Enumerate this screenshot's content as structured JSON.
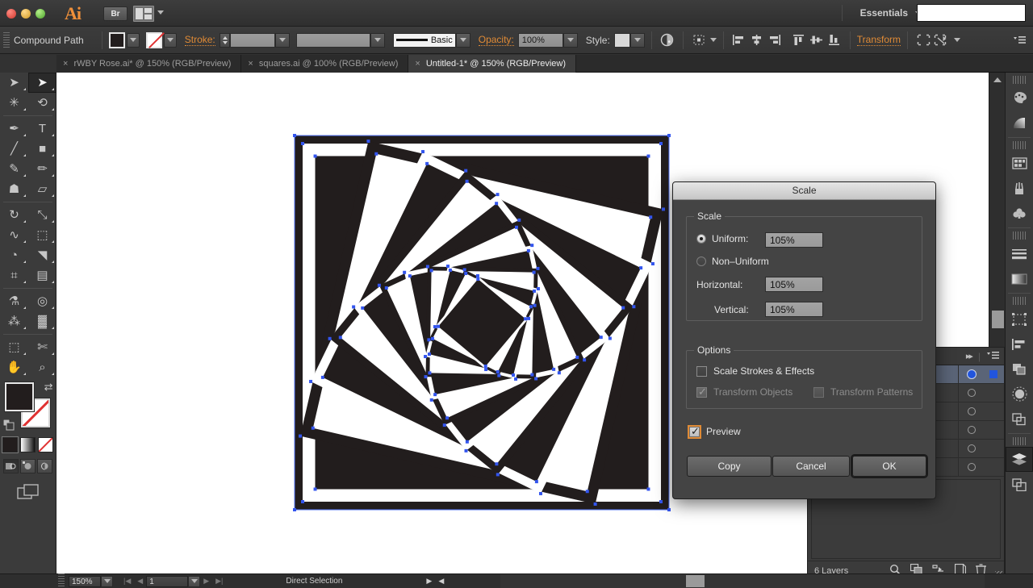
{
  "app": {
    "name": "Ai",
    "bridge_label": "Br",
    "workspace": "Essentials",
    "search_value": ""
  },
  "control_bar": {
    "selection_label": "Compound Path",
    "fill_icon": "fill-swatch-icon",
    "stroke_swatch_icon": "stroke-none-swatch-icon",
    "stroke_label": "Stroke:",
    "stroke_weight": "",
    "stroke_profile": "",
    "brush_label": "Basic",
    "opacity_label": "Opacity:",
    "opacity_value": "100%",
    "style_label": "Style:",
    "transform_label": "Transform",
    "recolor_icon": "recolor-artwork-icon",
    "align_icons": [
      "align-left-icon",
      "align-center-horizontal-icon",
      "align-right-icon",
      "align-top-icon",
      "align-center-vertical-icon",
      "align-bottom-icon"
    ],
    "isolate_icon": "isolate-selected-icon",
    "mask_icon": "edit-clipping-path-icon",
    "panel_menu_icon": "panel-menu-icon"
  },
  "tabs": [
    {
      "label": "rWBY Rose.ai* @ 150% (RGB/Preview)",
      "active": false,
      "close": "×"
    },
    {
      "label": "squares.ai @ 100% (RGB/Preview)",
      "active": false,
      "close": "×"
    },
    {
      "label": "Untitled-1* @ 150% (RGB/Preview)",
      "active": true,
      "close": "×"
    }
  ],
  "toolbar": {
    "tools": [
      {
        "name": "selection-tool",
        "glyph": "➤",
        "selected": false
      },
      {
        "name": "direct-selection-tool",
        "glyph": "➤",
        "selected": true
      },
      {
        "name": "magic-wand-tool",
        "glyph": "✳",
        "selected": false
      },
      {
        "name": "lasso-tool",
        "glyph": "⟲",
        "selected": false
      },
      {
        "name": "pen-tool",
        "glyph": "✒",
        "selected": false
      },
      {
        "name": "type-tool",
        "glyph": "T",
        "selected": false
      },
      {
        "name": "line-segment-tool",
        "glyph": "╱",
        "selected": false
      },
      {
        "name": "rectangle-tool",
        "glyph": "■",
        "selected": false
      },
      {
        "name": "paintbrush-tool",
        "glyph": "✎",
        "selected": false
      },
      {
        "name": "pencil-tool",
        "glyph": "✏",
        "selected": false
      },
      {
        "name": "blob-brush-tool",
        "glyph": "☗",
        "selected": false
      },
      {
        "name": "eraser-tool",
        "glyph": "▱",
        "selected": false
      },
      {
        "name": "rotate-tool",
        "glyph": "↻",
        "selected": false
      },
      {
        "name": "scale-tool",
        "glyph": "⤡",
        "selected": false
      },
      {
        "name": "width-tool",
        "glyph": "∿",
        "selected": false
      },
      {
        "name": "free-transform-tool",
        "glyph": "⬚",
        "selected": false
      },
      {
        "name": "shape-builder-tool",
        "glyph": "◔",
        "selected": false
      },
      {
        "name": "perspective-grid-tool",
        "glyph": "◥",
        "selected": false
      },
      {
        "name": "mesh-tool",
        "glyph": "⌗",
        "selected": false
      },
      {
        "name": "gradient-tool",
        "glyph": "▤",
        "selected": false
      },
      {
        "name": "eyedropper-tool",
        "glyph": "⚗",
        "selected": false
      },
      {
        "name": "blend-tool",
        "glyph": "◎",
        "selected": false
      },
      {
        "name": "symbol-sprayer-tool",
        "glyph": "⁂",
        "selected": false
      },
      {
        "name": "column-graph-tool",
        "glyph": "▓",
        "selected": false
      },
      {
        "name": "artboard-tool",
        "glyph": "⬚",
        "selected": false
      },
      {
        "name": "slice-tool",
        "glyph": "✄",
        "selected": false
      },
      {
        "name": "hand-tool",
        "glyph": "✋",
        "selected": false
      },
      {
        "name": "zoom-tool",
        "glyph": "⌕",
        "selected": false
      }
    ],
    "fill_color": "#221d1d",
    "stroke_color": "none",
    "color_modes": [
      "color-swatch-mode",
      "gradient-mode",
      "none-mode"
    ],
    "draw_modes": [
      "draw-normal",
      "draw-behind",
      "draw-inside"
    ],
    "screen_mode": "change-screen-mode"
  },
  "dock_icons": [
    "color-panel-icon",
    "color-guide-panel-icon",
    "swatches-panel-icon",
    "brushes-panel-icon",
    "symbols-panel-icon",
    "stroke-panel-icon",
    "gradient-panel-icon",
    "transform-panel-icon",
    "align-panel-icon",
    "pathfinder-panel-icon",
    "transparency-panel-icon",
    "appearance-panel-icon",
    "layers-panel-icon",
    "artboards-panel-icon"
  ],
  "layers_panel": {
    "collapse_icon": "collapse-to-icons-icon",
    "menu_icon": "panel-menu-icon",
    "rows": [
      {
        "visible": true,
        "selected": true,
        "targeted": true
      },
      {
        "visible": true,
        "selected": false,
        "targeted": false
      },
      {
        "visible": true,
        "selected": false,
        "targeted": false
      },
      {
        "visible": true,
        "selected": false,
        "targeted": false
      },
      {
        "visible": true,
        "selected": false,
        "targeted": false
      },
      {
        "visible": true,
        "selected": false,
        "targeted": false
      }
    ],
    "count_label": "6 Layers",
    "footer_icons": [
      "locate-object-icon",
      "make-clipping-mask-icon",
      "create-new-sublayer-icon",
      "create-new-layer-icon",
      "delete-selection-icon"
    ]
  },
  "status_bar": {
    "zoom_value": "150%",
    "page_value": "1",
    "tool_status": "Direct Selection",
    "first_page_icon": "first-page-icon",
    "prev_page_icon": "previous-page-icon",
    "next_page_icon": "next-page-icon",
    "last_page_icon": "last-page-icon"
  },
  "dialog": {
    "title": "Scale",
    "scale_group_legend": "Scale",
    "uniform_label": "Uniform:",
    "uniform_value": "105%",
    "uniform_selected": true,
    "non_uniform_label": "Non–Uniform",
    "non_uniform_selected": false,
    "horizontal_label": "Horizontal:",
    "horizontal_value": "105%",
    "vertical_label": "Vertical:",
    "vertical_value": "105%",
    "options_group_legend": "Options",
    "scale_strokes_label": "Scale Strokes & Effects",
    "scale_strokes_checked": false,
    "transform_objects_label": "Transform Objects",
    "transform_objects_checked": true,
    "transform_objects_disabled": true,
    "transform_patterns_label": "Transform Patterns",
    "transform_patterns_checked": false,
    "transform_patterns_disabled": true,
    "preview_label": "Preview",
    "preview_checked": true,
    "copy_button": "Copy",
    "cancel_button": "Cancel",
    "ok_button": "OK",
    "accent_color": "#e08b36"
  },
  "artwork": {
    "description": "nested-rotating-squares-spiral",
    "fill_color": "#221d1d",
    "anchor_color": "#3355ee",
    "selection_color": "#5577ff",
    "squares": 11,
    "rotation_step_deg": 13,
    "shrink_ratio": 0.845
  }
}
